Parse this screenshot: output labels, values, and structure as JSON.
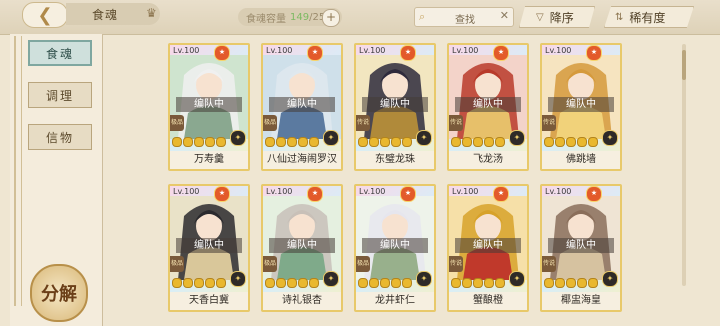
{
  "topbar": {
    "title": "食魂",
    "capacity_label": "食魂容量",
    "capacity_current": "149",
    "capacity_max": "/250",
    "search_placeholder": "查找",
    "sort_label": "降序",
    "rarity_label": "稀有度"
  },
  "sidebar": {
    "tabs": [
      {
        "label": "食魂",
        "active": true
      },
      {
        "label": "调理",
        "active": false
      },
      {
        "label": "信物",
        "active": false
      }
    ],
    "decompose_label": "分解"
  },
  "cards": [
    {
      "level": "Lv.100",
      "status": "编队中",
      "name": "万寿羹",
      "rank": "极品",
      "colors": [
        "#cfe4cf",
        "#f0f0f0",
        "#8aa890"
      ]
    },
    {
      "level": "Lv.100",
      "status": "编队中",
      "name": "八仙过海闹罗汉",
      "rank": "极品",
      "colors": [
        "#cfe0ea",
        "#dfe8ee",
        "#5b7aa0"
      ]
    },
    {
      "level": "Lv.100",
      "status": "编队中",
      "name": "东璧龙珠",
      "rank": "传说",
      "colors": [
        "#f2e6c0",
        "#2e2a3c",
        "#b08a3a"
      ]
    },
    {
      "level": "Lv.100",
      "status": "编队中",
      "name": "飞龙汤",
      "rank": "传说",
      "colors": [
        "#f3d3c9",
        "#b83a2a",
        "#e7c06a"
      ]
    },
    {
      "level": "Lv.100",
      "status": "编队中",
      "name": "佛跳墙",
      "rank": "传说",
      "colors": [
        "#f6e4c0",
        "#d59a3c",
        "#f1d27a"
      ]
    },
    {
      "level": "Lv.100",
      "status": "编队中",
      "name": "天香白冀",
      "rank": "极品",
      "colors": [
        "#e9e2c8",
        "#2b2a2e",
        "#d9c79a"
      ]
    },
    {
      "level": "Lv.100",
      "status": "编队中",
      "name": "诗礼银杏",
      "rank": "极品",
      "colors": [
        "#e5f0e0",
        "#c8c0b8",
        "#7faa8a"
      ]
    },
    {
      "level": "Lv.100",
      "status": "编队中",
      "name": "龙井虾仁",
      "rank": "极品",
      "colors": [
        "#eef3ea",
        "#e6e6ee",
        "#98b08c"
      ]
    },
    {
      "level": "Lv.100",
      "status": "编队中",
      "name": "蟹酿橙",
      "rank": "传说",
      "colors": [
        "#f6e0a8",
        "#d7a22a",
        "#c0392b"
      ]
    },
    {
      "level": "Lv.100",
      "status": "编队中",
      "name": "椰盅海皇",
      "rank": "传说",
      "colors": [
        "#efe4d4",
        "#8a6e5a",
        "#d6c2a0"
      ]
    }
  ]
}
